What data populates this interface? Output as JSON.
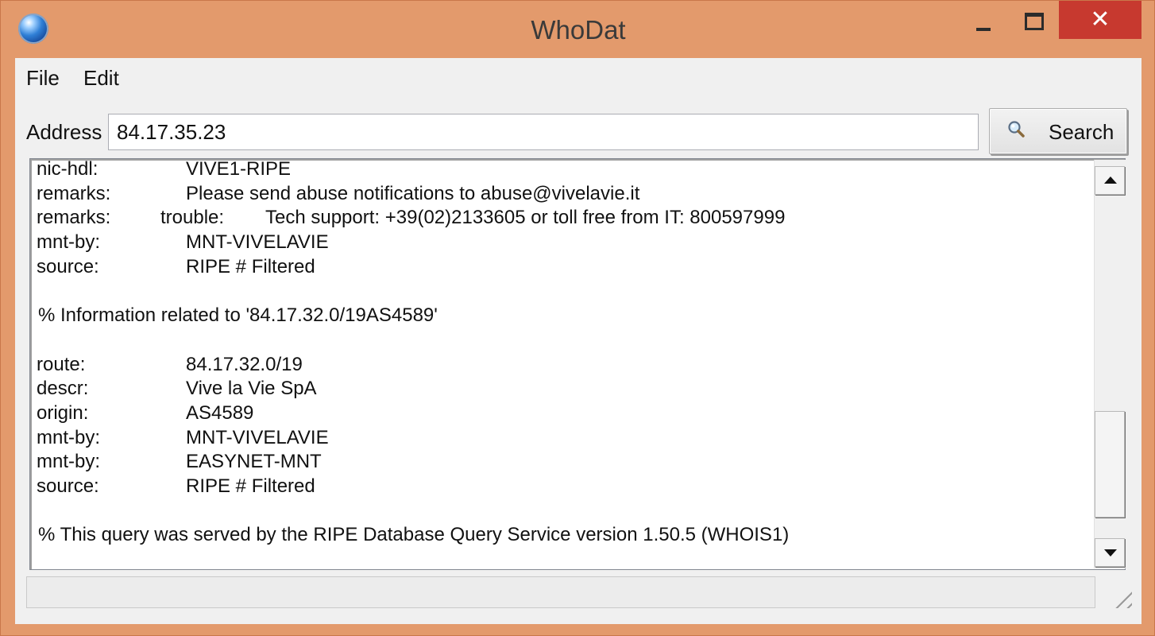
{
  "window": {
    "title": "WhoDat",
    "close_glyph": "✕"
  },
  "menu": {
    "file": "File",
    "edit": "Edit"
  },
  "address": {
    "label": "Address",
    "value": "84.17.35.23"
  },
  "search": {
    "label": "Search",
    "icon": "magnifier-icon"
  },
  "output": {
    "lines": [
      {
        "key": "nic-hdl:",
        "value": "VIVE1-RIPE"
      },
      {
        "key": "remarks:",
        "value": "Please send abuse notifications to abuse@vivelavie.it"
      },
      {
        "key": "remarks:",
        "value": "trouble:",
        "value2": "Tech support: +39(02)2133605 or toll free from IT: 800597999"
      },
      {
        "key": "mnt-by:",
        "value": "MNT-VIVELAVIE"
      },
      {
        "key": "source:",
        "value": "RIPE # Filtered"
      },
      {
        "text": ""
      },
      {
        "text": "% Information related to '84.17.32.0/19AS4589'"
      },
      {
        "text": ""
      },
      {
        "key": "route:",
        "value": "84.17.32.0/19"
      },
      {
        "key": "descr:",
        "value": "Vive la Vie SpA"
      },
      {
        "key": "origin:",
        "value": "AS4589"
      },
      {
        "key": "mnt-by:",
        "value": "MNT-VIVELAVIE"
      },
      {
        "key": "mnt-by:",
        "value": "EASYNET-MNT"
      },
      {
        "key": "source:",
        "value": "RIPE # Filtered"
      },
      {
        "text": ""
      },
      {
        "text": "% This query was served by the RIPE Database Query Service version 1.50.5 (WHOIS1)"
      }
    ]
  },
  "status": {
    "text": ""
  }
}
